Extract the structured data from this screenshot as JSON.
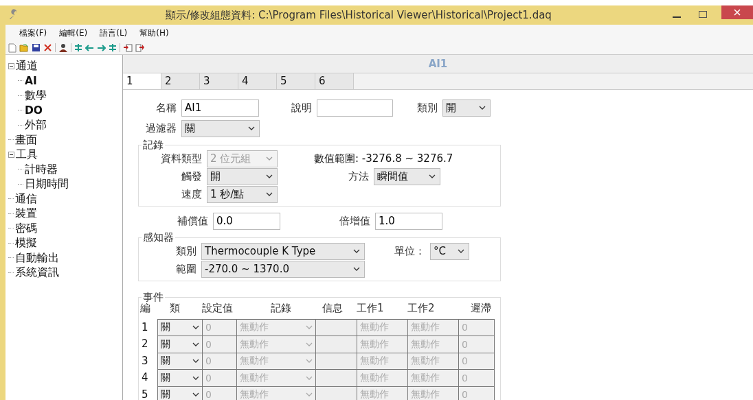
{
  "window": {
    "title": "顯示/修改組態資料: C:\\Program Files\\Historical Viewer\\Historical\\Project1.daq"
  },
  "menu": [
    "檔案(F)",
    "編輯(E)",
    "語言(L)",
    "幫助(H)"
  ],
  "sidebar": {
    "items": [
      {
        "label": "通道",
        "bold": false,
        "expanded": true,
        "children": [
          {
            "label": "AI",
            "bold": true
          },
          {
            "label": "數學",
            "bold": false
          },
          {
            "label": "DO",
            "bold": true
          },
          {
            "label": "外部",
            "bold": false
          }
        ]
      },
      {
        "label": "畫面",
        "bold": false
      },
      {
        "label": "工具",
        "bold": false,
        "expanded": true,
        "children": [
          {
            "label": "計時器",
            "bold": false
          },
          {
            "label": "日期時間",
            "bold": false
          }
        ]
      },
      {
        "label": "通信",
        "bold": false
      },
      {
        "label": "裝置",
        "bold": false
      },
      {
        "label": "密碼",
        "bold": false
      },
      {
        "label": "模擬",
        "bold": false
      },
      {
        "label": "自動輸出",
        "bold": false
      },
      {
        "label": "系統資訊",
        "bold": false
      }
    ]
  },
  "header": "AI1",
  "tabs": [
    {
      "label": "1",
      "selected": true
    },
    {
      "label": "2",
      "selected": false
    },
    {
      "label": "3",
      "selected": false
    },
    {
      "label": "4",
      "selected": false
    },
    {
      "label": "5",
      "selected": false
    },
    {
      "label": "6",
      "selected": false
    }
  ],
  "general": {
    "name": {
      "label": "名稱",
      "value": "AI1"
    },
    "description": {
      "label": "說明"
    },
    "category": {
      "label": "類別",
      "value": "開"
    },
    "filter": {
      "label": "過濾器",
      "value": "關"
    }
  },
  "record": {
    "title": "記錄",
    "data_type": {
      "label": "資料類型",
      "value": "2 位元組",
      "disabled": true
    },
    "trigger": {
      "label": "觸發",
      "value": "開",
      "disabled": false
    },
    "speed": {
      "label": "速度",
      "value": "1 秒/點",
      "disabled": false
    },
    "range_text": "數值範圍: -3276.8 ~ 3276.7",
    "method": {
      "label": "方法",
      "value": "瞬間值",
      "disabled": false
    }
  },
  "offset": {
    "label": "補償值",
    "value": "0.0"
  },
  "multiplier": {
    "label": "倍增值",
    "value": "1.0"
  },
  "sensor": {
    "title": "感知器",
    "type": {
      "label": "類別",
      "value": "Thermocouple K Type"
    },
    "range": {
      "label": "範圍",
      "value": "-270.0 ~ 1370.0"
    },
    "unit": {
      "label": "單位：",
      "value": "°C"
    }
  },
  "events": {
    "title": "事件",
    "columns": [
      "編",
      "類",
      "設定值",
      "記錄",
      "信息",
      "工作1",
      "工作2",
      "遲滯"
    ],
    "rows": [
      {
        "no": "1",
        "type": "關",
        "setpoint": "0",
        "record": "無動作",
        "task1": "無動作",
        "task2": "無動作",
        "hysteresis": "0",
        "disabled": true
      },
      {
        "no": "2",
        "type": "關",
        "setpoint": "0",
        "record": "無動作",
        "task1": "無動作",
        "task2": "無動作",
        "hysteresis": "0",
        "disabled": true
      },
      {
        "no": "3",
        "type": "關",
        "setpoint": "0",
        "record": "無動作",
        "task1": "無動作",
        "task2": "無動作",
        "hysteresis": "0",
        "disabled": true
      },
      {
        "no": "4",
        "type": "關",
        "setpoint": "0",
        "record": "無動作",
        "task1": "無動作",
        "task2": "無動作",
        "hysteresis": "0",
        "disabled": true
      },
      {
        "no": "5",
        "type": "關",
        "setpoint": "0",
        "record": "無動作",
        "task1": "無動作",
        "task2": "無動作",
        "hysteresis": "0",
        "disabled": true
      }
    ]
  }
}
